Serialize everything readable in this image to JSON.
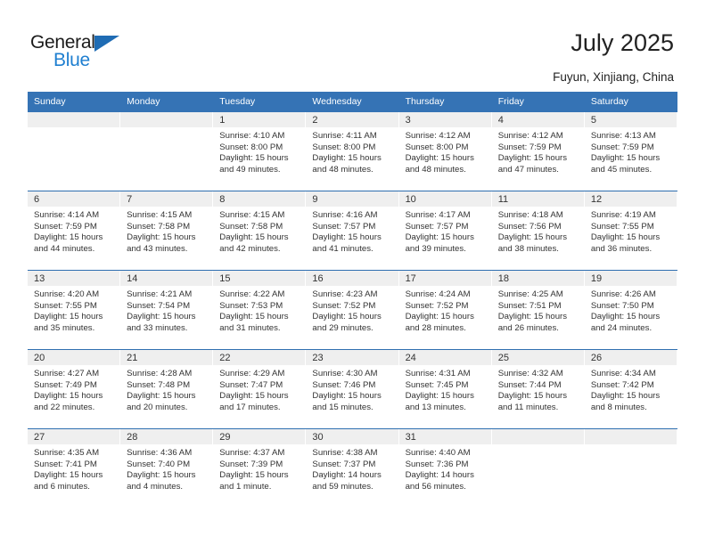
{
  "brand": {
    "name_dark": "General",
    "name_blue": "Blue",
    "triangle_color": "#1f6cb4",
    "blue_text_color": "#1f7fd0"
  },
  "header": {
    "title": "July 2025",
    "location": "Fuyun, Xinjiang, China"
  },
  "theme": {
    "header_blue": "#3573b5",
    "row_divider_blue": "#2f6fb0",
    "daynum_band": "#efefef"
  },
  "columns": [
    "Sunday",
    "Monday",
    "Tuesday",
    "Wednesday",
    "Thursday",
    "Friday",
    "Saturday"
  ],
  "labels": {
    "sunrise_prefix": "Sunrise:",
    "sunset_prefix": "Sunset:",
    "daylight_prefix": "Daylight:"
  },
  "weeks": [
    [
      {
        "day": "",
        "empty": true
      },
      {
        "day": "",
        "empty": true
      },
      {
        "day": "1",
        "sunrise": "Sunrise: 4:10 AM",
        "sunset": "Sunset: 8:00 PM",
        "daylight": "Daylight: 15 hours and 49 minutes."
      },
      {
        "day": "2",
        "sunrise": "Sunrise: 4:11 AM",
        "sunset": "Sunset: 8:00 PM",
        "daylight": "Daylight: 15 hours and 48 minutes."
      },
      {
        "day": "3",
        "sunrise": "Sunrise: 4:12 AM",
        "sunset": "Sunset: 8:00 PM",
        "daylight": "Daylight: 15 hours and 48 minutes."
      },
      {
        "day": "4",
        "sunrise": "Sunrise: 4:12 AM",
        "sunset": "Sunset: 7:59 PM",
        "daylight": "Daylight: 15 hours and 47 minutes."
      },
      {
        "day": "5",
        "sunrise": "Sunrise: 4:13 AM",
        "sunset": "Sunset: 7:59 PM",
        "daylight": "Daylight: 15 hours and 45 minutes."
      }
    ],
    [
      {
        "day": "6",
        "sunrise": "Sunrise: 4:14 AM",
        "sunset": "Sunset: 7:59 PM",
        "daylight": "Daylight: 15 hours and 44 minutes."
      },
      {
        "day": "7",
        "sunrise": "Sunrise: 4:15 AM",
        "sunset": "Sunset: 7:58 PM",
        "daylight": "Daylight: 15 hours and 43 minutes."
      },
      {
        "day": "8",
        "sunrise": "Sunrise: 4:15 AM",
        "sunset": "Sunset: 7:58 PM",
        "daylight": "Daylight: 15 hours and 42 minutes."
      },
      {
        "day": "9",
        "sunrise": "Sunrise: 4:16 AM",
        "sunset": "Sunset: 7:57 PM",
        "daylight": "Daylight: 15 hours and 41 minutes."
      },
      {
        "day": "10",
        "sunrise": "Sunrise: 4:17 AM",
        "sunset": "Sunset: 7:57 PM",
        "daylight": "Daylight: 15 hours and 39 minutes."
      },
      {
        "day": "11",
        "sunrise": "Sunrise: 4:18 AM",
        "sunset": "Sunset: 7:56 PM",
        "daylight": "Daylight: 15 hours and 38 minutes."
      },
      {
        "day": "12",
        "sunrise": "Sunrise: 4:19 AM",
        "sunset": "Sunset: 7:55 PM",
        "daylight": "Daylight: 15 hours and 36 minutes."
      }
    ],
    [
      {
        "day": "13",
        "sunrise": "Sunrise: 4:20 AM",
        "sunset": "Sunset: 7:55 PM",
        "daylight": "Daylight: 15 hours and 35 minutes."
      },
      {
        "day": "14",
        "sunrise": "Sunrise: 4:21 AM",
        "sunset": "Sunset: 7:54 PM",
        "daylight": "Daylight: 15 hours and 33 minutes."
      },
      {
        "day": "15",
        "sunrise": "Sunrise: 4:22 AM",
        "sunset": "Sunset: 7:53 PM",
        "daylight": "Daylight: 15 hours and 31 minutes."
      },
      {
        "day": "16",
        "sunrise": "Sunrise: 4:23 AM",
        "sunset": "Sunset: 7:52 PM",
        "daylight": "Daylight: 15 hours and 29 minutes."
      },
      {
        "day": "17",
        "sunrise": "Sunrise: 4:24 AM",
        "sunset": "Sunset: 7:52 PM",
        "daylight": "Daylight: 15 hours and 28 minutes."
      },
      {
        "day": "18",
        "sunrise": "Sunrise: 4:25 AM",
        "sunset": "Sunset: 7:51 PM",
        "daylight": "Daylight: 15 hours and 26 minutes."
      },
      {
        "day": "19",
        "sunrise": "Sunrise: 4:26 AM",
        "sunset": "Sunset: 7:50 PM",
        "daylight": "Daylight: 15 hours and 24 minutes."
      }
    ],
    [
      {
        "day": "20",
        "sunrise": "Sunrise: 4:27 AM",
        "sunset": "Sunset: 7:49 PM",
        "daylight": "Daylight: 15 hours and 22 minutes."
      },
      {
        "day": "21",
        "sunrise": "Sunrise: 4:28 AM",
        "sunset": "Sunset: 7:48 PM",
        "daylight": "Daylight: 15 hours and 20 minutes."
      },
      {
        "day": "22",
        "sunrise": "Sunrise: 4:29 AM",
        "sunset": "Sunset: 7:47 PM",
        "daylight": "Daylight: 15 hours and 17 minutes."
      },
      {
        "day": "23",
        "sunrise": "Sunrise: 4:30 AM",
        "sunset": "Sunset: 7:46 PM",
        "daylight": "Daylight: 15 hours and 15 minutes."
      },
      {
        "day": "24",
        "sunrise": "Sunrise: 4:31 AM",
        "sunset": "Sunset: 7:45 PM",
        "daylight": "Daylight: 15 hours and 13 minutes."
      },
      {
        "day": "25",
        "sunrise": "Sunrise: 4:32 AM",
        "sunset": "Sunset: 7:44 PM",
        "daylight": "Daylight: 15 hours and 11 minutes."
      },
      {
        "day": "26",
        "sunrise": "Sunrise: 4:34 AM",
        "sunset": "Sunset: 7:42 PM",
        "daylight": "Daylight: 15 hours and 8 minutes."
      }
    ],
    [
      {
        "day": "27",
        "sunrise": "Sunrise: 4:35 AM",
        "sunset": "Sunset: 7:41 PM",
        "daylight": "Daylight: 15 hours and 6 minutes."
      },
      {
        "day": "28",
        "sunrise": "Sunrise: 4:36 AM",
        "sunset": "Sunset: 7:40 PM",
        "daylight": "Daylight: 15 hours and 4 minutes."
      },
      {
        "day": "29",
        "sunrise": "Sunrise: 4:37 AM",
        "sunset": "Sunset: 7:39 PM",
        "daylight": "Daylight: 15 hours and 1 minute."
      },
      {
        "day": "30",
        "sunrise": "Sunrise: 4:38 AM",
        "sunset": "Sunset: 7:37 PM",
        "daylight": "Daylight: 14 hours and 59 minutes."
      },
      {
        "day": "31",
        "sunrise": "Sunrise: 4:40 AM",
        "sunset": "Sunset: 7:36 PM",
        "daylight": "Daylight: 14 hours and 56 minutes."
      },
      {
        "day": "",
        "empty": true
      },
      {
        "day": "",
        "empty": true
      }
    ]
  ]
}
